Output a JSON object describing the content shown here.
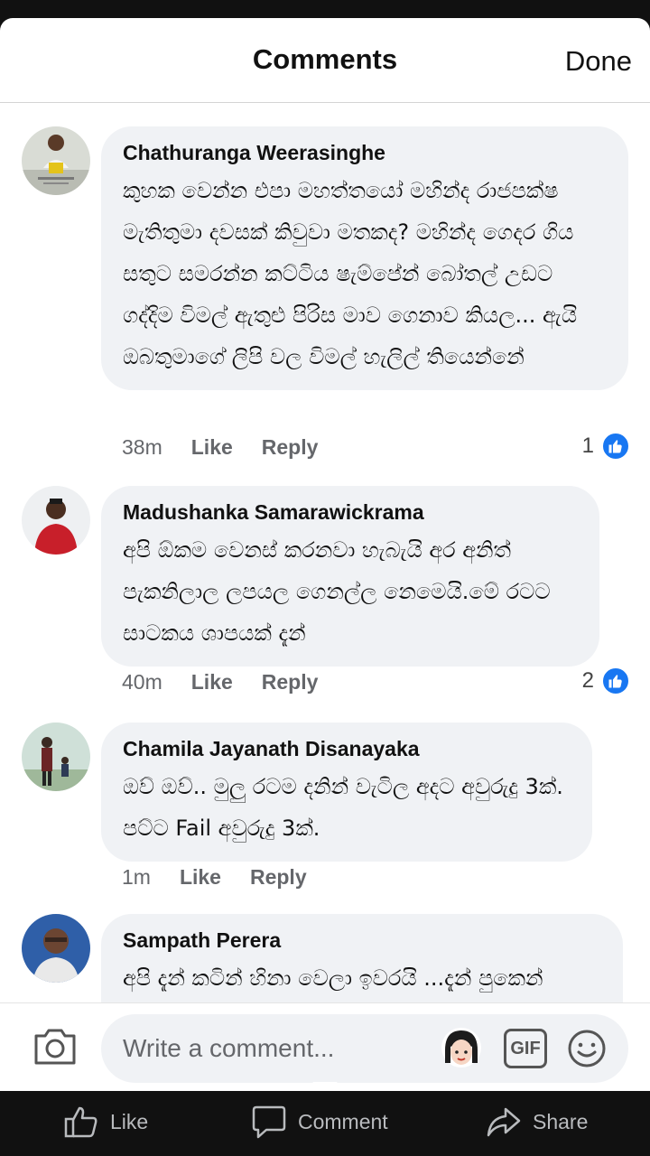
{
  "header": {
    "title": "Comments",
    "done_label": "Done"
  },
  "comments": [
    {
      "author": "Chathuranga Weerasinghe",
      "text": "කුහක වෙන්න එපා මහත්තයෝ මහින්ද රාජපක්ෂ මැතිතුමා දවසක් කිවුවා මතකද? මහින්ද ගෙදර ගිය සතුට සමරන්න කට්ටිය ෂැම්පේන් බෝතල් උඩට ගද්දිම විමල් ඇතුළු පිරිස මාව ගෙනාව කියල... ඇයි ඔබතුමාගේ ලිපි වල විමල් හැලිල් තියෙන්නේ",
      "time": "38m",
      "like_label": "Like",
      "reply_label": "Reply",
      "reactions": "1"
    },
    {
      "author": "Madushanka Samarawickrama",
      "text": "අපි ඕකම වෙනස් කරනවා හැබැයි අර අනිත් පැකනිලාල ලපයල ගෙනල්ල නෙමෙයි.මේ රටට සාටකය ශාපයක් දැන්",
      "time": "40m",
      "like_label": "Like",
      "reply_label": "Reply",
      "reactions": "2"
    },
    {
      "author": "Chamila Jayanath Disanayaka",
      "text": "ඔව් ඔව්.. මුලු රටම දනින් වැටිල අදට අවුරුදු 3ක්.  පට්ට Fail අවුරුදු 3ක්.",
      "time": "1m",
      "like_label": "Like",
      "reply_label": "Reply"
    },
    {
      "author": "Sampath Perera",
      "text": "අපි දැන් කටින් හිනා වෙලා ඉවරයි ...දැන් පුකෙන්"
    }
  ],
  "composer": {
    "placeholder": "Write a comment...",
    "gif_label": "GIF"
  },
  "bottom_bar": {
    "like_label": "Like",
    "comment_label": "Comment",
    "share_label": "Share"
  },
  "colors": {
    "accent": "#1877f2",
    "bubble": "#f0f2f5",
    "meta_text": "#65676b"
  }
}
